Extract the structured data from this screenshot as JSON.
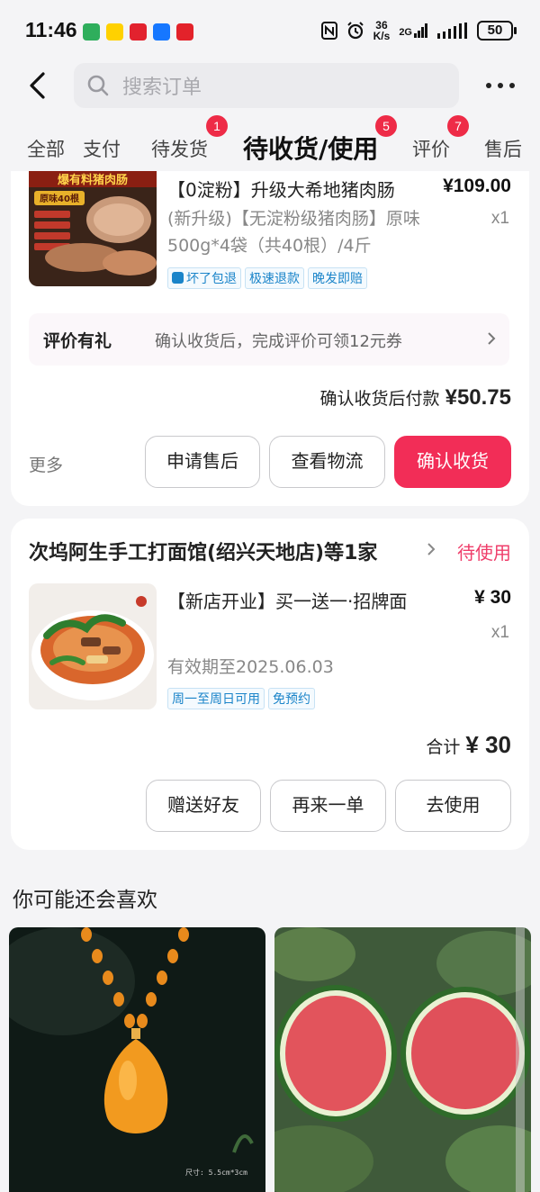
{
  "status_bar": {
    "time": "11:46",
    "net_speed_top": "36",
    "net_speed_bottom": "K/s",
    "signal2g": "2G",
    "battery": "50",
    "app_icons": [
      "house-app-icon",
      "meituan-app-icon",
      "tmall-app-icon",
      "feishu-app-icon",
      "dingdong-app-icon"
    ]
  },
  "header": {
    "search_placeholder": "搜索订单"
  },
  "tabs": {
    "all": "全部",
    "pay": "支付",
    "to_ship": "待发货",
    "to_ship_badge": "1",
    "to_receive": "待收货/使用",
    "to_receive_badge": "5",
    "review": "评价",
    "review_badge": "7",
    "after_sale": "售后"
  },
  "order1": {
    "title": "【0淀粉】升级大希地猪肉肠",
    "price": "¥109.00",
    "desc": "(新升级)【无淀粉级猪肉肠】原味500g*4袋（共40根）/4斤",
    "qty": "x1",
    "tags": [
      "坏了包退",
      "极速退款",
      "晚发即赔"
    ],
    "img_text_top": "爆有料猪肉肠",
    "img_text_badge": "原味40根",
    "promo_title": "评价有礼",
    "promo_text": "确认收货后，完成评价可领12元券",
    "pay_label": "确认收货后付款 ",
    "pay_amount": "¥50.75",
    "more": "更多",
    "btn_after_sale": "申请售后",
    "btn_logistics": "查看物流",
    "btn_confirm": "确认收货"
  },
  "order2": {
    "shop": "次坞阿生手工打面馆(绍兴天地店)等1家",
    "status": "待使用",
    "title": "【新店开业】买一送一·招牌面",
    "price": "¥ 30",
    "qty": "x1",
    "validity": "有效期至2025.06.03",
    "tags": [
      "周一至周日可用",
      "免预约"
    ],
    "total_label": "合计 ",
    "total_amount": "¥ 30",
    "btn_gift": "赠送好友",
    "btn_again": "再来一单",
    "btn_use": "去使用"
  },
  "recommend": {
    "title": "你可能还会喜欢",
    "item1_caption": "尺寸: 5.5cm*3cm"
  },
  "colors": {
    "accent": "#f22d57",
    "badge": "#ee2b47",
    "tag_blue": "#1a84c9",
    "status_pink": "#ef3d6a"
  }
}
